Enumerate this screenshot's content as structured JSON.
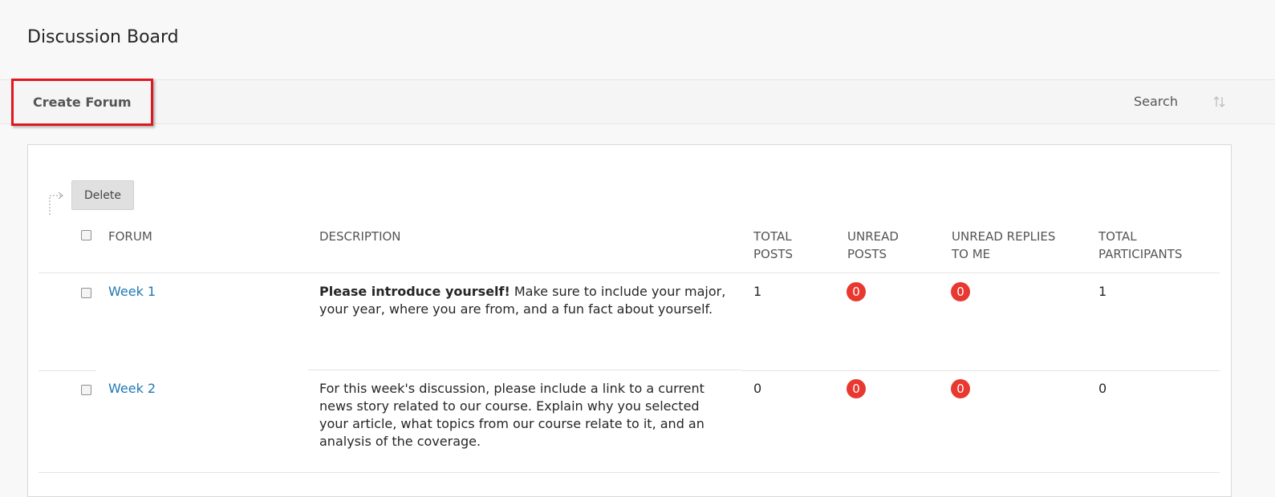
{
  "page": {
    "title": "Discussion Board"
  },
  "action_bar": {
    "create_forum_label": "Create Forum",
    "search_label": "Search",
    "highlight_color": "#e0171d"
  },
  "bulk_actions": {
    "delete_label": "Delete"
  },
  "table": {
    "headers": {
      "forum": "FORUM",
      "description": "DESCRIPTION",
      "total_posts": "TOTAL POSTS",
      "unread_posts": "UNREAD POSTS",
      "unread_replies": "UNREAD REPLIES TO ME",
      "total_participants": "TOTAL PARTICIPANTS"
    },
    "rows": [
      {
        "forum": "Week 1",
        "description_bold": "Please introduce yourself!",
        "description_text": " Make sure to include your major, your year, where you are from, and a fun fact about yourself.",
        "total_posts": "1",
        "unread_posts": "0",
        "unread_replies": "0",
        "total_participants": "1"
      },
      {
        "forum": "Week 2",
        "description_bold": "",
        "description_text": "For this week's discussion, please include a link to a current news story related to our course. Explain why you selected your article, what topics from our course relate to it, and an analysis of the coverage.",
        "total_posts": "0",
        "unread_posts": "0",
        "unread_replies": "0",
        "total_participants": "0"
      }
    ]
  },
  "colors": {
    "link": "#1f78b4",
    "badge": "#e8382f"
  }
}
